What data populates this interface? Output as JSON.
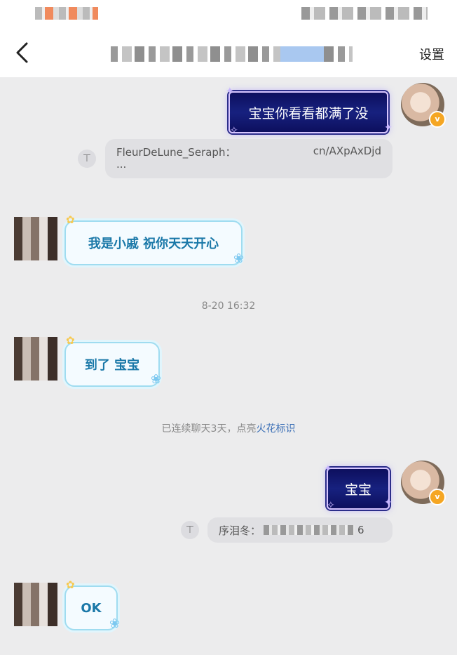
{
  "header": {
    "settings_label": "设置"
  },
  "messages": {
    "m1_text": "宝宝你看看都满了没",
    "q1_name": "FleurDeLune_Seraph：",
    "q1_link": "cn/AXpAxDjd",
    "q1_more": "...",
    "m2_text": "我是小戚 祝你天天开心",
    "timestamp": "8-20 16:32",
    "m3_text": "到了 宝宝",
    "sys_prefix": "已连续聊天3天，点亮",
    "sys_link": "火花标识",
    "m4_text": "宝宝",
    "q2_name": "序泪冬：",
    "q2_tail": "6",
    "m5_text": "OK"
  },
  "icons": {
    "back": "chevron-left-icon",
    "quote": "quote-top-icon",
    "badge": "verified-badge-icon"
  },
  "colors": {
    "bg": "#ececed",
    "my_bubble": "#13177a",
    "other_bubble_text": "#1a78a8",
    "badge": "#f5a623",
    "link": "#3b6fb6"
  }
}
